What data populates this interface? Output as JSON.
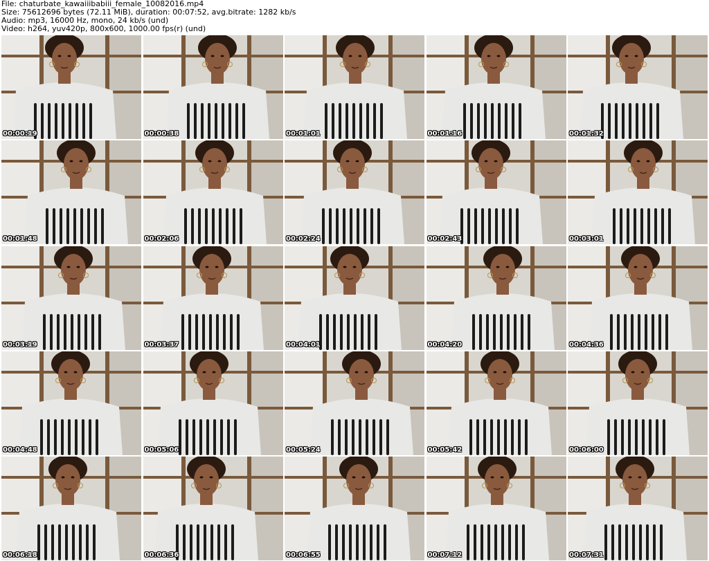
{
  "header": {
    "file_line": "File: chaturbate_kawaiiibabiii_female_10082016.mp4",
    "size_line": "Size: 75612696 bytes (72.11 MiB), duration: 00:07:52, avg.bitrate: 1282 kb/s",
    "audio_line": "Audio: mp3, 16000 Hz, mono, 24 kb/s (und)",
    "video_line": "Video: h264, yuv420p, 800x600, 1000.00 fps(r) (und)"
  },
  "thumbnails": [
    {
      "timestamp": "00:00:19"
    },
    {
      "timestamp": "00:00:38"
    },
    {
      "timestamp": "00:01:01"
    },
    {
      "timestamp": "00:01:16"
    },
    {
      "timestamp": "00:01:32"
    },
    {
      "timestamp": "00:01:48"
    },
    {
      "timestamp": "00:02:06"
    },
    {
      "timestamp": "00:02:24"
    },
    {
      "timestamp": "00:02:43"
    },
    {
      "timestamp": "00:03:01"
    },
    {
      "timestamp": "00:03:19"
    },
    {
      "timestamp": "00:03:37"
    },
    {
      "timestamp": "00:04:01"
    },
    {
      "timestamp": "00:04:20"
    },
    {
      "timestamp": "00:04:36"
    },
    {
      "timestamp": "00:04:48"
    },
    {
      "timestamp": "00:05:06"
    },
    {
      "timestamp": "00:05:24"
    },
    {
      "timestamp": "00:05:42"
    },
    {
      "timestamp": "00:06:00"
    },
    {
      "timestamp": "00:06:18"
    },
    {
      "timestamp": "00:06:36"
    },
    {
      "timestamp": "00:06:55"
    },
    {
      "timestamp": "00:07:12"
    },
    {
      "timestamp": "00:07:31"
    }
  ],
  "colors": {
    "background": "#ffffff",
    "header_text": "#000000",
    "timestamp_text": "#ffffff",
    "wall": "#d9d6cf",
    "frame_wood": "#7a5a3c",
    "skin": "#8a5a3e",
    "hair": "#2b1a10",
    "shirt": "#e8e8e6",
    "stripes": "#1c1c1c"
  }
}
